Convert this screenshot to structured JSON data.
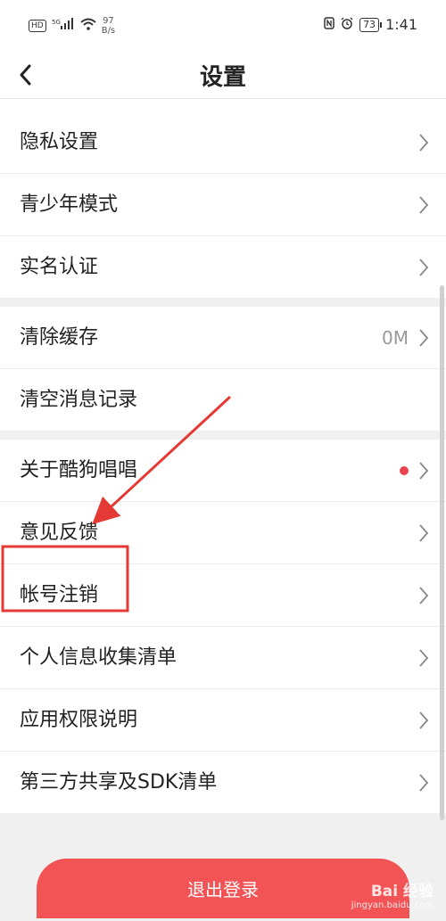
{
  "status_bar": {
    "hd_badge": "HD",
    "signal": "5G",
    "net_speed_value": "97",
    "net_speed_unit": "B/s",
    "battery": "73",
    "time": "1:41"
  },
  "header": {
    "title": "设置"
  },
  "groups": [
    {
      "items": [
        {
          "label": "隐私设置"
        },
        {
          "label": "青少年模式"
        },
        {
          "label": "实名认证"
        }
      ]
    },
    {
      "items": [
        {
          "label": "清除缓存",
          "value": "0M"
        },
        {
          "label": "清空消息记录"
        }
      ]
    },
    {
      "items": [
        {
          "label": "关于酷狗唱唱",
          "badge_dot": true
        },
        {
          "label": "意见反馈"
        },
        {
          "label": "帐号注销"
        },
        {
          "label": "个人信息收集清单"
        },
        {
          "label": "应用权限说明"
        },
        {
          "label": "第三方共享及SDK清单"
        }
      ]
    }
  ],
  "logout_label": "退出登录",
  "watermark": {
    "text": "Bai 经验",
    "url": "jingyan.baidu.com"
  },
  "colors": {
    "accent": "#f25355",
    "annotation": "#e53935"
  }
}
